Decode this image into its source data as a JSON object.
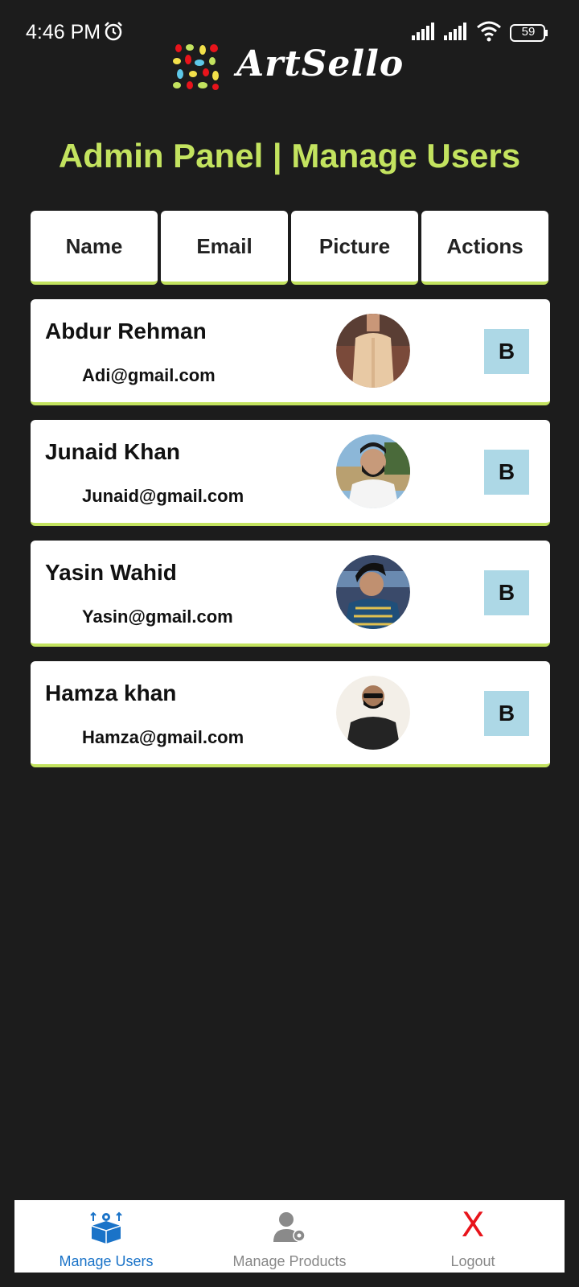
{
  "status_bar": {
    "time": "4:46 PM",
    "battery": "59",
    "icons": [
      "alarm-icon",
      "signal-icon",
      "signal-icon",
      "wifi-icon",
      "battery-icon"
    ]
  },
  "app": {
    "logo_text": "ArtSello"
  },
  "page": {
    "title": "Admin Panel | Manage Users"
  },
  "table": {
    "headers": [
      "Name",
      "Email",
      "Picture",
      "Actions"
    ],
    "rows": [
      {
        "name": "Abdur Rehman",
        "email": "Adi@gmail.com",
        "picture": "avatar-photo",
        "action": "B"
      },
      {
        "name": "Junaid Khan",
        "email": "Junaid@gmail.com",
        "picture": "avatar-photo",
        "action": "B"
      },
      {
        "name": "Yasin Wahid",
        "email": "Yasin@gmail.com",
        "picture": "avatar-photo",
        "action": "B"
      },
      {
        "name": "Hamza khan",
        "email": "Hamza@gmail.com",
        "picture": "avatar-photo",
        "action": "B"
      }
    ]
  },
  "bottom_nav": {
    "items": [
      {
        "label": "Manage Users",
        "icon": "box-gear-icon",
        "active": true
      },
      {
        "label": "Manage Products",
        "icon": "user-gear-icon",
        "active": false
      },
      {
        "label": "Logout",
        "icon": "X",
        "active": false
      }
    ]
  },
  "colors": {
    "background": "#1c1c1c",
    "accent": "#c3e35f",
    "action_button": "#add8e6",
    "active_nav": "#1a73c8",
    "inactive_nav": "#888888",
    "logout": "#e8141b"
  }
}
